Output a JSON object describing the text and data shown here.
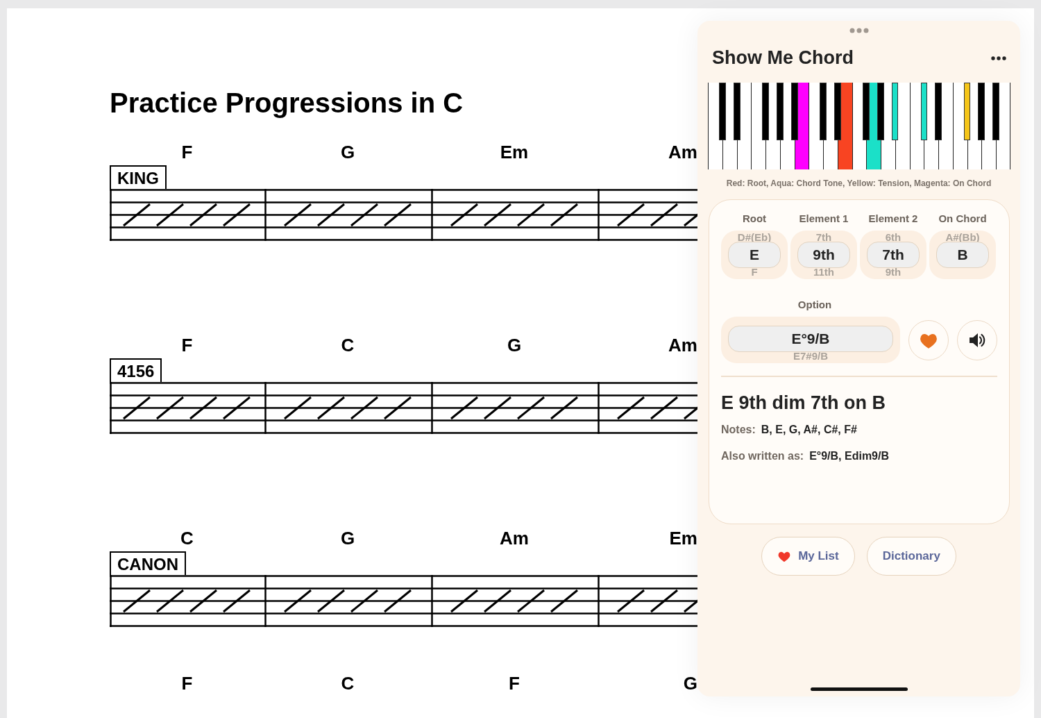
{
  "sheet": {
    "title": "Practice Progressions in C",
    "systems": [
      {
        "label": "KING",
        "staff": true,
        "chords": [
          "F",
          "G",
          "Em",
          "Am"
        ]
      },
      {
        "label": "4156",
        "staff": true,
        "chords": [
          "F",
          "C",
          "G",
          "Am"
        ]
      },
      {
        "label": "CANON",
        "staff": true,
        "chords": [
          "C",
          "G",
          "Am",
          "Em"
        ]
      },
      {
        "staff": false,
        "chords": [
          "F",
          "C",
          "F",
          "G"
        ]
      }
    ]
  },
  "panel": {
    "title": "Show Me Chord",
    "keyboard": {
      "keys": [
        {
          "kind": "white"
        },
        {
          "kind": "black"
        },
        {
          "kind": "white"
        },
        {
          "kind": "black"
        },
        {
          "kind": "white"
        },
        {
          "kind": "white"
        },
        {
          "kind": "black"
        },
        {
          "kind": "white"
        },
        {
          "kind": "black"
        },
        {
          "kind": "white"
        },
        {
          "kind": "black"
        },
        {
          "kind": "white",
          "color": "#ff00ff"
        },
        {
          "kind": "white"
        },
        {
          "kind": "black"
        },
        {
          "kind": "white"
        },
        {
          "kind": "black"
        },
        {
          "kind": "white",
          "color": "#f84422"
        },
        {
          "kind": "white"
        },
        {
          "kind": "black"
        },
        {
          "kind": "white",
          "color": "#1be0c8"
        },
        {
          "kind": "black"
        },
        {
          "kind": "white"
        },
        {
          "kind": "black",
          "color": "#1be0c8"
        },
        {
          "kind": "white"
        },
        {
          "kind": "white"
        },
        {
          "kind": "black",
          "color": "#1be0c8"
        },
        {
          "kind": "white"
        },
        {
          "kind": "black"
        },
        {
          "kind": "white"
        },
        {
          "kind": "white"
        },
        {
          "kind": "black",
          "color": "#f5c518"
        },
        {
          "kind": "white"
        },
        {
          "kind": "black"
        },
        {
          "kind": "white"
        },
        {
          "kind": "black"
        },
        {
          "kind": "white"
        }
      ],
      "legend": "Red: Root, Aqua: Chord Tone, Yellow: Tension, Magenta: On Chord"
    },
    "pickers": [
      {
        "heading": "Root",
        "above": "D#(Eb)",
        "value": "E",
        "below": "F"
      },
      {
        "heading": "Element 1",
        "above": "7th",
        "value": "9th",
        "below": "11th"
      },
      {
        "heading": "Element 2",
        "above": "6th",
        "value": "7th",
        "below": "9th"
      },
      {
        "heading": "On Chord",
        "above": "A#(Bb)",
        "value": "B"
      }
    ],
    "option": {
      "heading": "Option",
      "value": "E°9/B",
      "below": "E7#9/B",
      "favorite": true
    },
    "result": {
      "title": "E 9th dim 7th on B",
      "notes_label": "Notes:",
      "notes": "B, E, G, A#, C#, F#",
      "also_label": "Also written as:",
      "also": "E°9/B, Edim9/B"
    },
    "buttons": [
      {
        "kind": "favorites",
        "label": "My List"
      },
      {
        "kind": "plain",
        "label": "Dictionary"
      }
    ]
  }
}
